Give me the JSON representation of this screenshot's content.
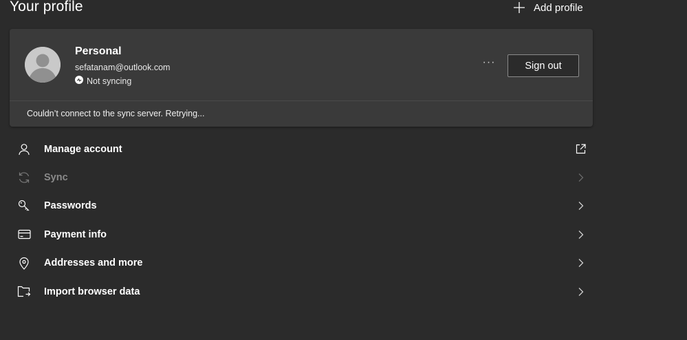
{
  "header": {
    "title": "Your profile",
    "add_profile_label": "Add profile"
  },
  "profile": {
    "name": "Personal",
    "email": "sefatanam@outlook.com",
    "sync_status": "Not syncing",
    "more_label": "···",
    "sign_out_label": "Sign out",
    "sync_error": "Couldn’t connect to the sync server. Retrying..."
  },
  "menu": {
    "items": [
      {
        "label": "Manage account",
        "icon": "person-icon",
        "trailing": "external-link-icon",
        "enabled": true
      },
      {
        "label": "Sync",
        "icon": "sync-icon",
        "trailing": "chevron-right-icon",
        "enabled": false
      },
      {
        "label": "Passwords",
        "icon": "key-icon",
        "trailing": "chevron-right-icon",
        "enabled": true
      },
      {
        "label": "Payment info",
        "icon": "credit-card-icon",
        "trailing": "chevron-right-icon",
        "enabled": true
      },
      {
        "label": "Addresses and more",
        "icon": "location-pin-icon",
        "trailing": "chevron-right-icon",
        "enabled": true
      },
      {
        "label": "Import browser data",
        "icon": "import-folder-icon",
        "trailing": "chevron-right-icon",
        "enabled": true
      }
    ]
  },
  "colors": {
    "background": "#2b2b2b",
    "card": "#3a3a3a",
    "text": "#ffffff",
    "disabled_text": "#8a8a8a"
  }
}
